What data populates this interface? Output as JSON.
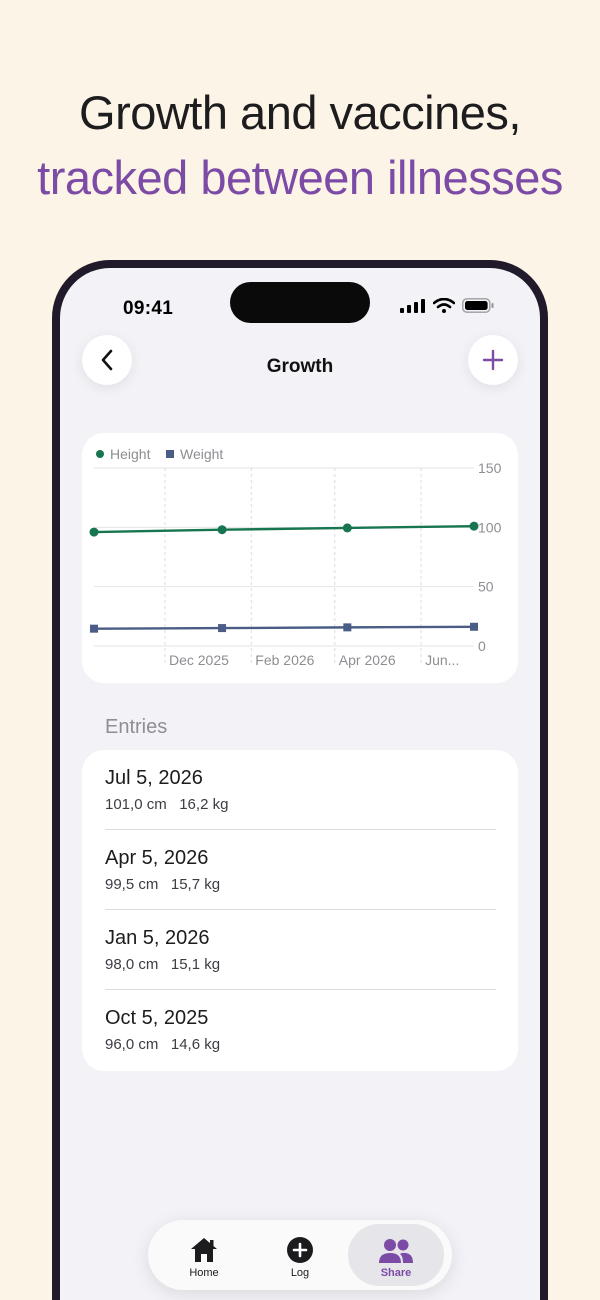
{
  "headline": {
    "line1": "Growth and vaccines,",
    "line2": "tracked between illnesses",
    "accent_color": "#7b4ba6"
  },
  "status_bar": {
    "time": "09:41",
    "icons": [
      "signal-icon",
      "wifi-icon",
      "battery-icon"
    ]
  },
  "nav": {
    "title": "Growth",
    "back_icon": "chevron-left-icon",
    "add_icon": "plus-icon"
  },
  "chart_data": {
    "type": "line",
    "legend": [
      "Height",
      "Weight"
    ],
    "legend_placement": "top-left",
    "x_tick_labels": [
      "Dec 2025",
      "Feb 2026",
      "Apr 2026",
      "Jun..."
    ],
    "y_ticks": [
      "0",
      "50",
      "100",
      "150"
    ],
    "ylim": [
      0,
      150
    ],
    "y_axis_side": "right",
    "grid": true,
    "series": [
      {
        "name": "Height",
        "color": "#17754f",
        "marker": "circle",
        "x": [
          "2025-10-05",
          "2026-01-05",
          "2026-04-05",
          "2026-07-05"
        ],
        "values": [
          96.0,
          98.0,
          99.5,
          101.0
        ]
      },
      {
        "name": "Weight",
        "color": "#4a5d86",
        "marker": "square",
        "x": [
          "2025-10-05",
          "2026-01-05",
          "2026-04-05",
          "2026-07-05"
        ],
        "values": [
          14.6,
          15.1,
          15.7,
          16.2
        ]
      }
    ]
  },
  "entries": {
    "section_label": "Entries",
    "items": [
      {
        "date": "Jul 5, 2026",
        "height": "101,0 cm",
        "weight": "16,2 kg"
      },
      {
        "date": "Apr 5, 2026",
        "height": "99,5 cm",
        "weight": "15,7 kg"
      },
      {
        "date": "Jan 5, 2026",
        "height": "98,0 cm",
        "weight": "15,1 kg"
      },
      {
        "date": "Oct 5, 2025",
        "height": "96,0 cm",
        "weight": "14,6 kg"
      }
    ]
  },
  "tabbar": {
    "active": "Share",
    "tabs": [
      {
        "label": "Home",
        "icon": "house-icon"
      },
      {
        "label": "Log",
        "icon": "plus-circle-icon"
      },
      {
        "label": "Share",
        "icon": "people-icon"
      }
    ]
  }
}
